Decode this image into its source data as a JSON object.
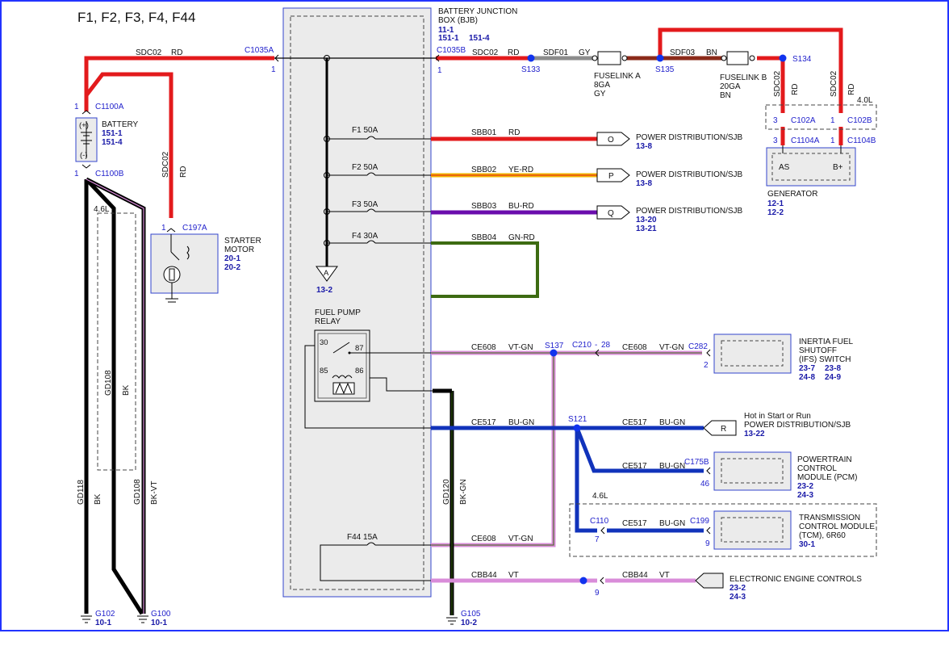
{
  "title": "F1, F2, F3, F4, F44",
  "bjb": {
    "line1": "BATTERY JUNCTION",
    "line2": "BOX (BJB)",
    "ref1": "11-1",
    "ref2": "151-1",
    "ref3": "151-4"
  },
  "connectors": {
    "c1035a": "C1035A",
    "c1035b": "C1035B",
    "c1100a": "C1100A",
    "c1100b": "C1100B",
    "c197a": "C197A",
    "c102a": "C102A",
    "c102b": "C102B",
    "c1104a": "C1104A",
    "c1104b": "C1104B",
    "c282": "C282",
    "c210": "C210",
    "c175b": "C175B",
    "c199": "C199",
    "c110": "C110"
  },
  "splices": {
    "s133": "S133",
    "s135": "S135",
    "s134": "S134",
    "s137": "S137",
    "s121": "S121"
  },
  "pins": {
    "one": "1",
    "two": "2",
    "three": "3",
    "seven": "7",
    "nine": "9",
    "n28": "28",
    "n46": "46",
    "dash": "-"
  },
  "circuits": {
    "sdc02": "SDC02",
    "sdf01": "SDF01",
    "sdf03": "SDF03",
    "sbb01": "SBB01",
    "sbb02": "SBB02",
    "sbb03": "SBB03",
    "sbb04": "SBB04",
    "ce608": "CE608",
    "ce517": "CE517",
    "cbb44": "CBB44",
    "gd118": "GD118",
    "gd108": "GD108",
    "gd120": "GD120"
  },
  "colors_text": {
    "rd": "RD",
    "gy": "GY",
    "bn": "BN",
    "ye_rd": "YE-RD",
    "bu_rd": "BU-RD",
    "gn_rd": "GN-RD",
    "vt_gn": "VT-GN",
    "bu_gn": "BU-GN",
    "vt": "VT",
    "bk": "BK",
    "bk_vt": "BK-VT",
    "bk_gn": "BK-GN"
  },
  "fuses": {
    "f1": "F1  50A",
    "f2": "F2  50A",
    "f3": "F3  50A",
    "f4": "F4  30A",
    "f44": "F44  15A"
  },
  "fuselink_a": {
    "name": "FUSELINK A",
    "gauge": "8GA",
    "color": "GY"
  },
  "fuselink_b": {
    "name": "FUSELINK B",
    "gauge": "20GA",
    "color": "BN"
  },
  "battery": {
    "label": "BATTERY",
    "ref1": "151-1",
    "ref2": "151-4",
    "plus": "(+)",
    "minus": "(-)"
  },
  "starter": {
    "line1": "STARTER",
    "line2": "MOTOR",
    "ref1": "20-1",
    "ref2": "20-2"
  },
  "generator": {
    "label": "GENERATOR",
    "ref1": "12-1",
    "ref2": "12-2",
    "as": "AS",
    "bplus": "B+",
    "engine": "4.0L"
  },
  "engine_46": "4.6L",
  "power_dist": "POWER DISTRIBUTION/SJB",
  "pd_o": {
    "letter": "O",
    "ref": "13-8"
  },
  "pd_p": {
    "letter": "P",
    "ref": "13-8"
  },
  "pd_q": {
    "letter": "Q",
    "ref1": "13-20",
    "ref2": "13-21"
  },
  "pd_r": {
    "letter": "R",
    "line1": "Hot in Start or Run",
    "ref": "13-22"
  },
  "ref_a": {
    "letter": "A",
    "ref": "13-2"
  },
  "relay": {
    "line1": "FUEL PUMP",
    "line2": "RELAY",
    "p30": "30",
    "p87": "87",
    "p85": "85",
    "p86": "86"
  },
  "ifs": {
    "line1": "INERTIA FUEL",
    "line2": "SHUTOFF",
    "line3": "(IFS) SWITCH",
    "r1": "23-7",
    "r2": "23-8",
    "r3": "24-8",
    "r4": "24-9"
  },
  "pcm": {
    "line1": "POWERTRAIN",
    "line2": "CONTROL",
    "line3": "MODULE (PCM)",
    "r1": "23-2",
    "r2": "24-3"
  },
  "tcm": {
    "line1": "TRANSMISSION",
    "line2": "CONTROL MODULE",
    "line3": "(TCM), 6R60",
    "r1": "30-1"
  },
  "eec": {
    "label": "ELECTRONIC ENGINE CONTROLS",
    "r1": "23-2",
    "r2": "24-3"
  },
  "grounds": {
    "g102": "G102",
    "g100": "G100",
    "g105": "G105",
    "ref": "10-1",
    "ref2": "10-2"
  },
  "wire_colors": {
    "red": "#e31a1c",
    "gray": "#8c8c8c",
    "brown": "#8b2a1a",
    "yellow": "#f0b400",
    "violet": "#6a0dad",
    "green": "#3d6b12",
    "pink": "#d98cd9",
    "blue": "#1133bb",
    "black": "#000000",
    "box_blue": "#3344cc"
  }
}
